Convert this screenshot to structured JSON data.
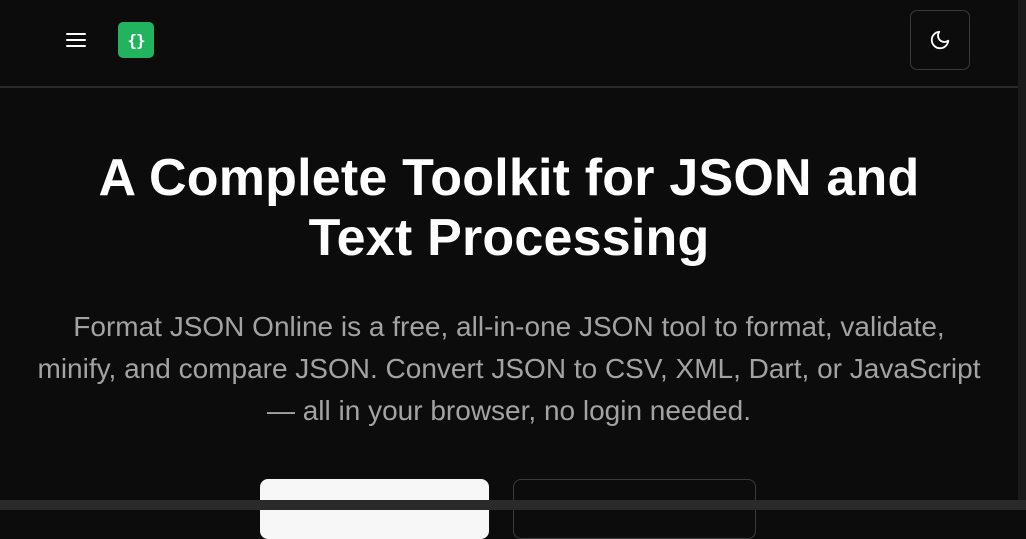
{
  "header": {
    "menu_icon": "hamburger-menu-icon",
    "logo_text": "{}",
    "theme_icon": "moon-icon"
  },
  "hero": {
    "title": "A Complete Toolkit for JSON and Text Processing",
    "subtitle": "Format JSON Online is a free, all-in-one JSON tool to format, validate, minify, and compare JSON. Convert JSON to CSV, XML, Dart, or JavaScript — all in your browser, no login needed."
  },
  "colors": {
    "background": "#0c0c0c",
    "logo_green": "#22b35e",
    "subtitle_gray": "#a3a3a3",
    "border": "#2a2a2a"
  }
}
